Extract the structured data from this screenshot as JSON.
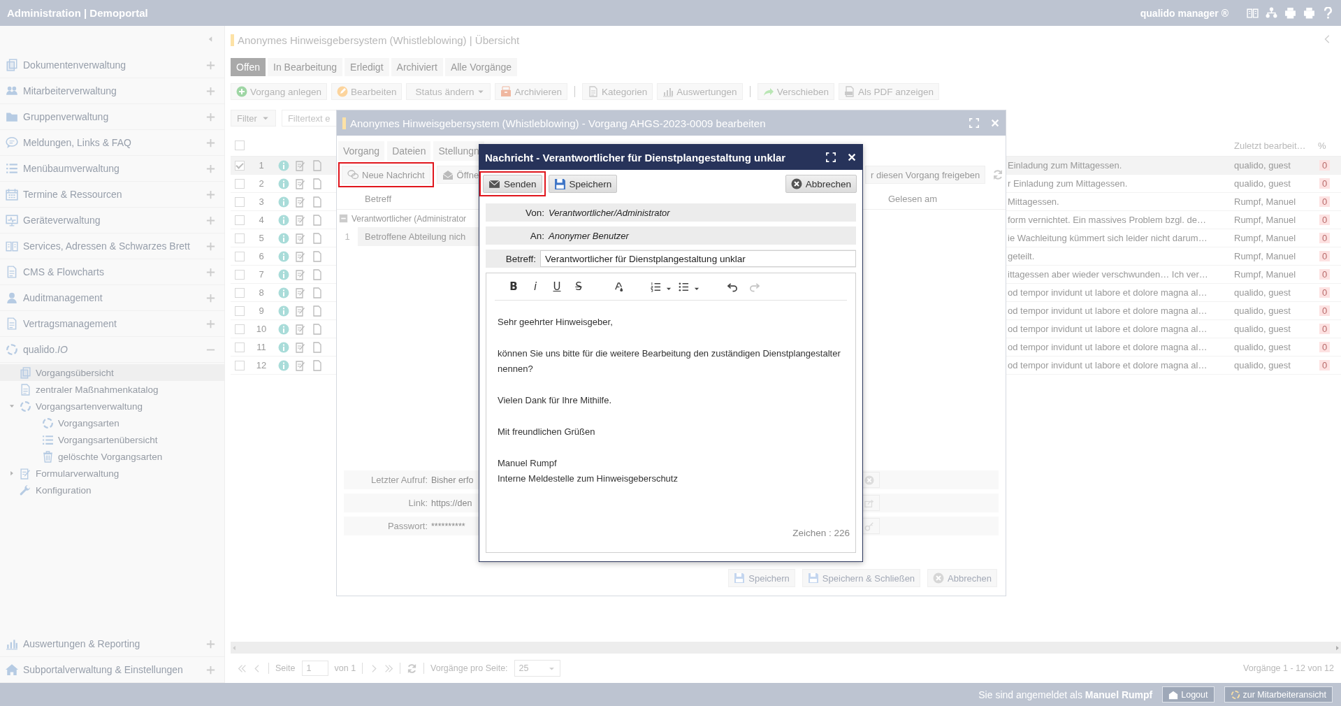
{
  "app_header": {
    "title": "Administration | Demoportal",
    "user_label": "qualido manager ®"
  },
  "sidebar": {
    "items": [
      {
        "label": "Dokumentenverwaltung",
        "expanded": false
      },
      {
        "label": "Mitarbeiterverwaltung",
        "expanded": false
      },
      {
        "label": "Gruppenverwaltung",
        "expanded": false
      },
      {
        "label": "Meldungen, Links & FAQ",
        "expanded": false
      },
      {
        "label": "Menübaumverwaltung",
        "expanded": false
      },
      {
        "label": "Termine & Ressourcen",
        "expanded": false
      },
      {
        "label": "Geräteverwaltung",
        "expanded": false
      },
      {
        "label": "Services, Adressen & Schwarzes Brett",
        "expanded": false
      },
      {
        "label": "CMS & Flowcharts",
        "expanded": false
      },
      {
        "label": "Auditmanagement",
        "expanded": false
      },
      {
        "label": "Vertragsmanagement",
        "expanded": false
      },
      {
        "label": "qualido.*IO*",
        "expanded": true,
        "children": [
          {
            "label": "Vorgangsübersicht",
            "selected": true
          },
          {
            "label": "zentraler Maßnahmenkatalog",
            "selected": false
          },
          {
            "label": "Vorgangsartenverwaltung",
            "selected": false,
            "expanded": true,
            "children": [
              {
                "label": "Vorgangsarten",
                "selected": false
              },
              {
                "label": "Vorgangsartenübersicht",
                "selected": false
              },
              {
                "label": "gelöschte Vorgangsarten",
                "selected": false
              }
            ]
          },
          {
            "label": "Formularverwaltung",
            "selected": false,
            "expanded": false
          },
          {
            "label": "Konfiguration",
            "selected": false
          }
        ]
      }
    ],
    "bottom_items": [
      {
        "label": "Auswertungen & Reporting",
        "expanded": false
      },
      {
        "label": "Subportalverwaltung & Einstellungen",
        "expanded": false
      }
    ]
  },
  "page_title": "Anonymes Hinweisgebersystem (Whistleblowing) | Übersicht",
  "tabs": [
    {
      "label": "Offen",
      "selected": true
    },
    {
      "label": "In Bearbeitung",
      "selected": false
    },
    {
      "label": "Erledigt",
      "selected": false
    },
    {
      "label": "Archiviert",
      "selected": false
    },
    {
      "label": "Alle Vorgänge",
      "selected": false
    }
  ],
  "toolbar": [
    [
      {
        "label": "Vorgang anlegen",
        "kind": "button"
      },
      {
        "label": "Bearbeiten",
        "kind": "button"
      },
      {
        "label": "Status ändern",
        "kind": "dropdown"
      },
      {
        "label": "Archivieren",
        "kind": "button"
      }
    ],
    [
      {
        "label": "Kategorien",
        "kind": "button"
      },
      {
        "label": "Auswertungen",
        "kind": "button"
      }
    ],
    [
      {
        "label": "Verschieben",
        "kind": "button"
      },
      {
        "label": "Als PDF anzeigen",
        "kind": "button"
      }
    ]
  ],
  "filter": {
    "label": "Filter",
    "placeholder": "Filtertext e"
  },
  "table": {
    "select_all_checked": false,
    "columns": [
      "Zuletzt bearbeit…",
      "%"
    ],
    "rows": [
      {
        "number": "1",
        "checked": true,
        "selected": true,
        "text": "Einladung zum Mittagessen.",
        "editor": "qualido, guest",
        "percent": "0"
      },
      {
        "number": "2",
        "checked": false,
        "selected": false,
        "text": "r Einladung zum Mittagessen.",
        "editor": "qualido, guest",
        "percent": "0"
      },
      {
        "number": "3",
        "checked": false,
        "selected": false,
        "text": "Mittagessen.",
        "editor": "Rumpf, Manuel",
        "percent": "0"
      },
      {
        "number": "4",
        "checked": false,
        "selected": false,
        "text": "form vernichtet. Ein massives Problem bzgl. de…",
        "editor": "Rumpf, Manuel",
        "percent": "0"
      },
      {
        "number": "5",
        "checked": false,
        "selected": false,
        "text": "ie Wachleitung kümmert sich leider nicht darum…",
        "editor": "Rumpf, Manuel",
        "percent": "0"
      },
      {
        "number": "6",
        "checked": false,
        "selected": false,
        "text": "geteilt.",
        "editor": "Rumpf, Manuel",
        "percent": "0"
      },
      {
        "number": "7",
        "checked": false,
        "selected": false,
        "text": "ittagessen aber wieder verschwunden… Ich ver…",
        "editor": "Rumpf, Manuel",
        "percent": "0"
      },
      {
        "number": "8",
        "checked": false,
        "selected": false,
        "text": "od tempor invidunt ut labore et dolore magna al…",
        "editor": "qualido, guest",
        "percent": "0"
      },
      {
        "number": "9",
        "checked": false,
        "selected": false,
        "text": "od tempor invidunt ut labore et dolore magna al…",
        "editor": "qualido, guest",
        "percent": "0"
      },
      {
        "number": "10",
        "checked": false,
        "selected": false,
        "text": "od tempor invidunt ut labore et dolore magna al…",
        "editor": "qualido, guest",
        "percent": "0"
      },
      {
        "number": "11",
        "checked": false,
        "selected": false,
        "text": "od tempor invidunt ut labore et dolore magna al…",
        "editor": "qualido, guest",
        "percent": "0"
      },
      {
        "number": "12",
        "checked": false,
        "selected": false,
        "text": "od tempor invidunt ut labore et dolore magna al…",
        "editor": "qualido, guest",
        "percent": "0"
      }
    ]
  },
  "pagination": {
    "page_label": "Seite",
    "page": "1",
    "of": "von 1",
    "per_page_label": "Vorgänge pro Seite:",
    "per_page": "25",
    "summary": "Vorgänge 1 - 12 von 12"
  },
  "status_bar": {
    "text": "Sie sind angemeldet als **Manuel Rumpf**",
    "buttons": [
      "Logout",
      "zur Mitarbeiteransicht"
    ]
  },
  "case_dialog": {
    "title": "Anonymes Hinweisgebersystem (Whistleblowing) - Vorgang AHGS-2023-0009 bearbeiten",
    "tabs": [
      {
        "label": "Vorgang",
        "selected": false
      },
      {
        "label": "Dateien",
        "selected": false
      },
      {
        "label": "Stellungn",
        "selected": false
      }
    ],
    "toolbar": [
      {
        "label": "Neue Nachricht",
        "highlighted": true
      },
      {
        "label": "Öffne",
        "highlighted": false
      }
    ],
    "release_button": "r diesen Vorgang freigeben",
    "grid": {
      "columns": [
        "Betreff",
        "Gelesen am"
      ],
      "group": {
        "label": "Verantwortlicher (Administrator",
        "expanded": true
      },
      "rows": [
        {
          "number": "1",
          "subject": "Betroffene Abteilung nich"
        }
      ]
    },
    "fields": [
      {
        "label": "Letzter Aufruf:",
        "value": "Bisher erfo"
      },
      {
        "label": "Link:",
        "value": "https://den"
      },
      {
        "label": "Passwort:",
        "value": "**********"
      }
    ],
    "buttons": [
      "Speichern",
      "Speichern & Schließen",
      "Abbrechen"
    ]
  },
  "message_dialog": {
    "title": "Nachricht - Verantwortlicher für Dienstplangestaltung unklar",
    "toolbar": [
      {
        "label": "Senden",
        "highlighted": true
      },
      {
        "label": "Speichern",
        "highlighted": false
      }
    ],
    "cancel": "Abbrechen",
    "from": {
      "label": "Von:",
      "value": "Verantwortlicher/Administrator"
    },
    "to": {
      "label": "An:",
      "value": "Anonymer Benutzer"
    },
    "subject": {
      "label": "Betreff:",
      "value": "Verantwortlicher für Dienstplangestaltung unklar"
    },
    "editor_tools": [
      {
        "kind": "bold",
        "label": "B",
        "disabled": false
      },
      {
        "kind": "italic",
        "label": "i",
        "disabled": false
      },
      {
        "kind": "underline",
        "label": "U",
        "disabled": false
      },
      {
        "kind": "strike",
        "label": "S",
        "disabled": false
      },
      {
        "kind": "color",
        "disabled": false
      },
      {
        "kind": "ordered",
        "disabled": false
      },
      {
        "kind": "bullet",
        "disabled": false
      },
      {
        "kind": "undo",
        "disabled": false
      },
      {
        "kind": "redo",
        "disabled": true
      }
    ],
    "body": [
      [
        "Sehr geehrter Hinweisgeber,"
      ],
      [
        "können Sie uns bitte für die weitere Bearbeitung den zuständigen Dienstplangestalter nennen?"
      ],
      [
        "Vielen Dank für Ihre Mithilfe."
      ],
      [
        "Mit freundlichen Grüßen"
      ],
      [
        "Manuel Rumpf",
        "Interne Meldestelle zum Hinweisgeberschutz"
      ]
    ],
    "char_count": "Zeichen : 226"
  }
}
